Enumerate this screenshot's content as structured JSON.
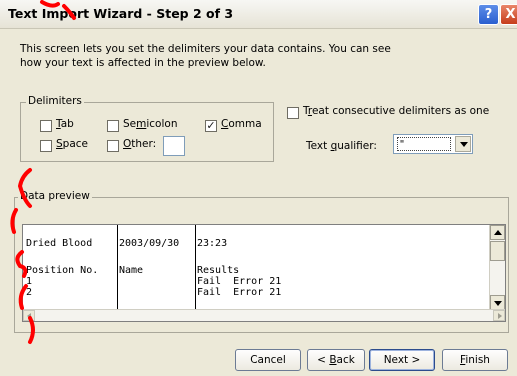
{
  "window": {
    "title": "Text Import Wizard - Step 2 of 3",
    "help_label": "?",
    "close_label": "X"
  },
  "intro_lines": [
    "This screen lets you set the delimiters your data contains.  You can see",
    "how your text is affected in the preview below."
  ],
  "delimiters": {
    "legend": "Delimiters",
    "tab": {
      "label_u": "T",
      "label_rest": "ab",
      "checked": false
    },
    "semicolon": {
      "label_pre": "Se",
      "label_u": "m",
      "label_rest": "icolon",
      "checked": false
    },
    "comma": {
      "label_u": "C",
      "label_rest": "omma",
      "checked": true
    },
    "space": {
      "label_u": "S",
      "label_rest": "pace",
      "checked": false
    },
    "other": {
      "label_u": "O",
      "label_rest": "ther:",
      "checked": false,
      "value": ""
    }
  },
  "consecutive": {
    "label_pre": "T",
    "label_u": "r",
    "label_rest": "eat consecutive delimiters as one",
    "checked": false
  },
  "text_qualifier": {
    "label_pre": "Text ",
    "label_u": "q",
    "label_rest": "ualifier:",
    "value": "\""
  },
  "preview": {
    "legend": "Data preview",
    "rows": [
      [
        "Dried Blood",
        "2003/09/30",
        "23:23"
      ],
      [
        "",
        "",
        ""
      ],
      [
        "Position No.",
        "Name",
        "Results"
      ],
      [
        "1",
        "",
        "Fail  Error 21"
      ],
      [
        "2",
        "",
        "Fail  Error 21"
      ]
    ]
  },
  "buttons": {
    "cancel": "Cancel",
    "back_pre": "< ",
    "back_u": "B",
    "back_rest": "ack",
    "next": "Next >",
    "finish_u": "F",
    "finish_rest": "inish"
  },
  "colors": {
    "dialog_bg": "#ece9d8",
    "watermark": "#ff0000"
  }
}
